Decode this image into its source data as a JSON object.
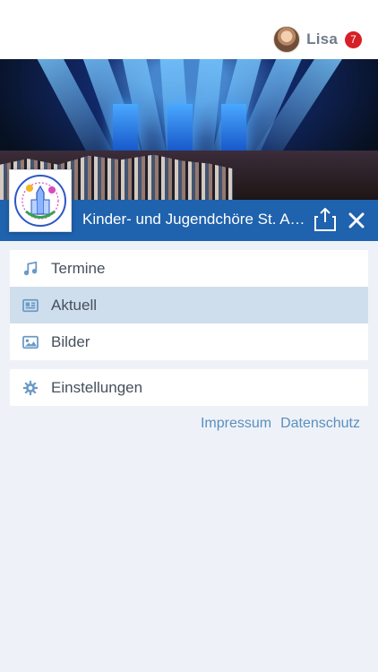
{
  "user": {
    "name": "Lisa",
    "notification_count": "7"
  },
  "header": {
    "title": "Kinder- und Jugendchöre  St. Aegidius"
  },
  "menu": [
    {
      "label": "Termine",
      "icon": "music-note-icon"
    },
    {
      "label": "Aktuell",
      "icon": "newspaper-icon",
      "selected": true
    },
    {
      "label": "Bilder",
      "icon": "image-icon"
    }
  ],
  "settings": {
    "label": "Einstellungen",
    "icon": "gear-icon"
  },
  "footer": {
    "impressum": "Impressum",
    "datenschutz": "Datenschutz"
  },
  "logo": {
    "text_top": "Kinder- und Jugendchöre",
    "text_center": "St. Aegidius",
    "text_bottom": "Wiedenbrück"
  },
  "colors": {
    "accent": "#1f62ad",
    "selected_row": "#cfdeec",
    "badge": "#d61f26",
    "link": "#5a8fbd",
    "page_bg": "#eef2f8"
  }
}
